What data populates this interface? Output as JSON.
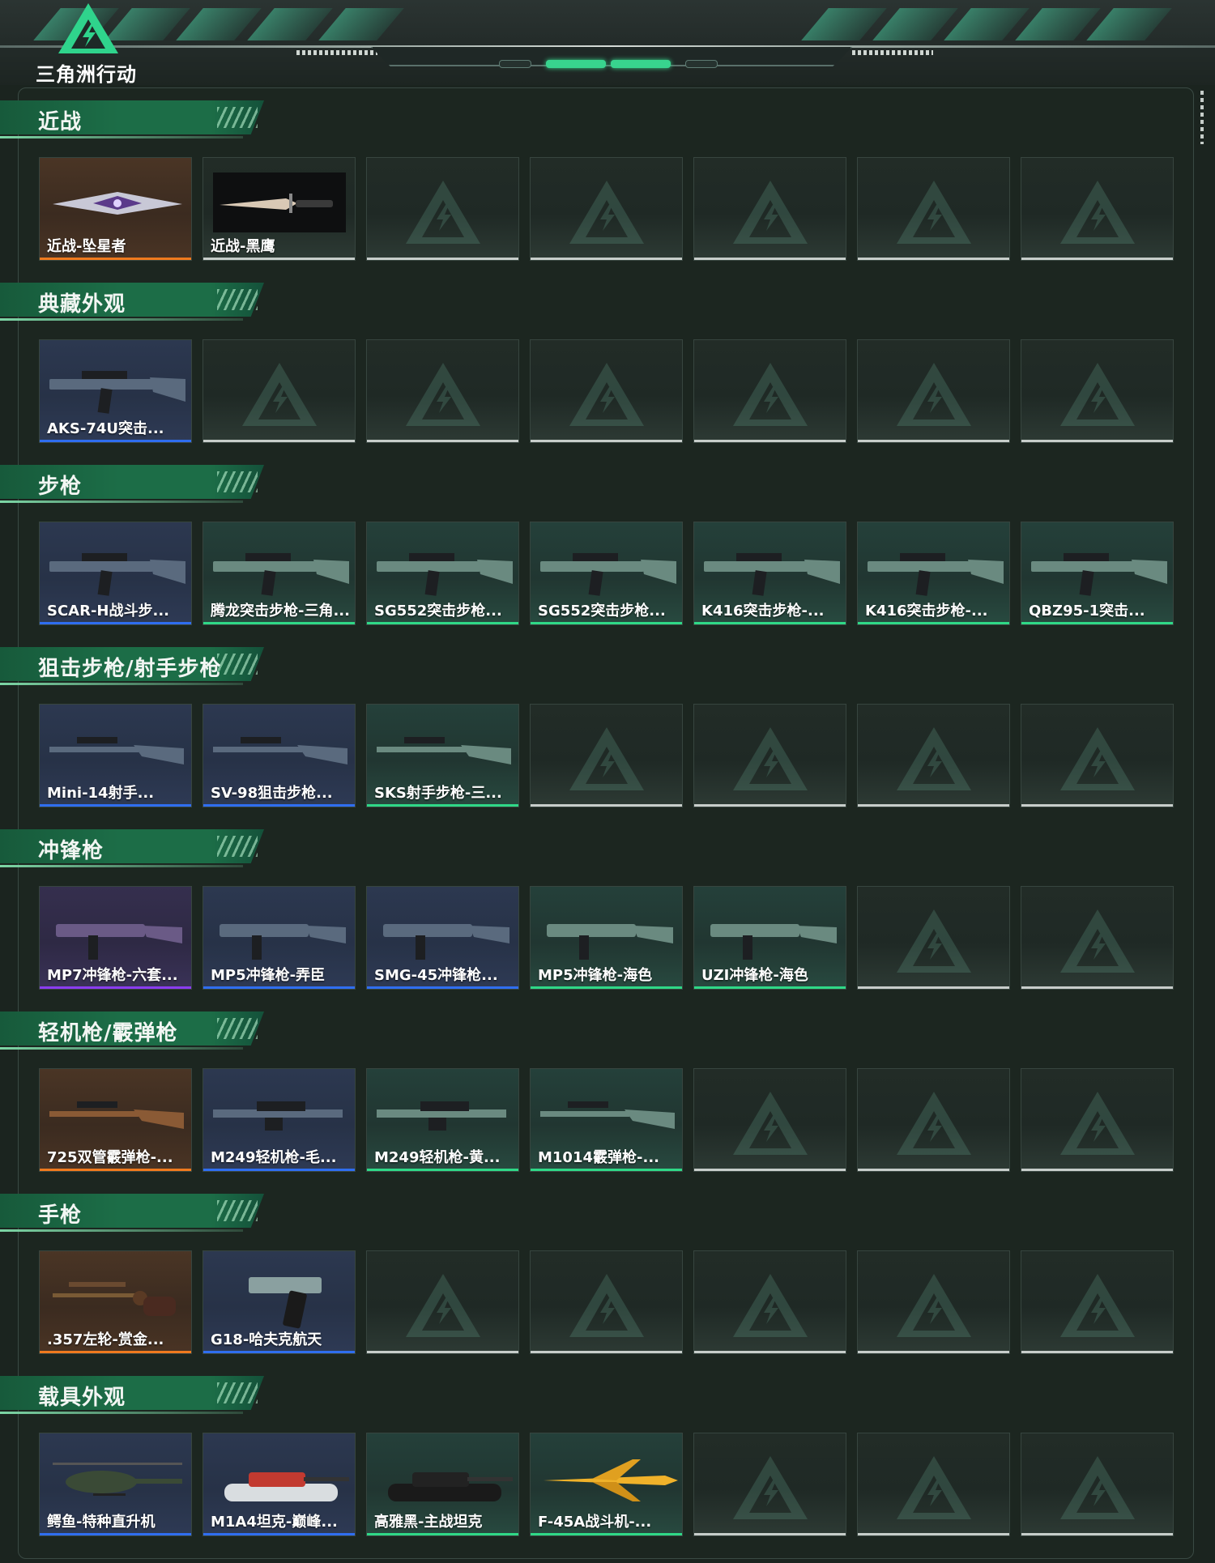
{
  "app": {
    "logo_text": "三角洲行动"
  },
  "colors": {
    "orange": "#f07a1e",
    "blue": "#2f6ef0",
    "green": "#2fd887",
    "purple": "#8a3cf0",
    "empty": "#c7cdca"
  },
  "sections": [
    {
      "title": "近战",
      "items": [
        {
          "label": "近战-坠星者",
          "rarity": "orange",
          "icon": "knife-icon"
        },
        {
          "label": "近战-黑鹰",
          "rarity": "empty-dark",
          "icon": "combat-knife-icon"
        }
      ]
    },
    {
      "title": "典藏外观",
      "items": [
        {
          "label": "AKS-74U突击...",
          "rarity": "blue",
          "icon": "rifle-icon"
        }
      ]
    },
    {
      "title": "步枪",
      "items": [
        {
          "label": "SCAR-H战斗步...",
          "rarity": "blue",
          "icon": "rifle-icon"
        },
        {
          "label": "腾龙突击步枪-三角...",
          "rarity": "green",
          "icon": "rifle-icon"
        },
        {
          "label": "SG552突击步枪...",
          "rarity": "green",
          "icon": "rifle-icon"
        },
        {
          "label": "SG552突击步枪...",
          "rarity": "green",
          "icon": "rifle-icon"
        },
        {
          "label": "K416突击步枪-...",
          "rarity": "green",
          "icon": "rifle-icon"
        },
        {
          "label": "K416突击步枪-...",
          "rarity": "green",
          "icon": "rifle-icon"
        },
        {
          "label": "QBZ95-1突击...",
          "rarity": "green",
          "icon": "rifle-icon"
        }
      ]
    },
    {
      "title": "狙击步枪/射手步枪",
      "items": [
        {
          "label": "Mini-14射手...",
          "rarity": "blue",
          "icon": "sniper-icon"
        },
        {
          "label": "SV-98狙击步枪...",
          "rarity": "blue",
          "icon": "sniper-icon"
        },
        {
          "label": "SKS射手步枪-三...",
          "rarity": "green",
          "icon": "sniper-icon"
        }
      ]
    },
    {
      "title": "冲锋枪",
      "items": [
        {
          "label": "MP7冲锋枪-六套...",
          "rarity": "purple",
          "icon": "smg-icon"
        },
        {
          "label": "MP5冲锋枪-弄臣",
          "rarity": "blue",
          "icon": "smg-icon"
        },
        {
          "label": "SMG-45冲锋枪...",
          "rarity": "blue",
          "icon": "smg-icon"
        },
        {
          "label": "MP5冲锋枪-海色",
          "rarity": "green",
          "icon": "smg-icon"
        },
        {
          "label": "UZI冲锋枪-海色",
          "rarity": "green",
          "icon": "smg-icon"
        }
      ]
    },
    {
      "title": "轻机枪/霰弹枪",
      "items": [
        {
          "label": "725双管霰弹枪-...",
          "rarity": "orange",
          "icon": "shotgun-icon"
        },
        {
          "label": "M249轻机枪-毛...",
          "rarity": "blue",
          "icon": "lmg-icon"
        },
        {
          "label": "M249轻机枪-黄...",
          "rarity": "green",
          "icon": "lmg-icon"
        },
        {
          "label": "M1014霰弹枪-...",
          "rarity": "green",
          "icon": "shotgun-icon"
        }
      ]
    },
    {
      "title": "手枪",
      "items": [
        {
          "label": ".357左轮-赏金...",
          "rarity": "orange",
          "icon": "revolver-icon"
        },
        {
          "label": "G18-哈夫克航天",
          "rarity": "blue",
          "icon": "pistol-icon"
        }
      ]
    },
    {
      "title": "载具外观",
      "items": [
        {
          "label": "鳄鱼-特种直升机",
          "rarity": "blue",
          "icon": "helicopter-icon"
        },
        {
          "label": "M1A4坦克-巅峰...",
          "rarity": "blue",
          "icon": "tank-icon"
        },
        {
          "label": "高雅黑-主战坦克",
          "rarity": "green",
          "icon": "tank-icon"
        },
        {
          "label": "F-45A战斗机-...",
          "rarity": "green",
          "icon": "jet-icon"
        }
      ]
    }
  ]
}
